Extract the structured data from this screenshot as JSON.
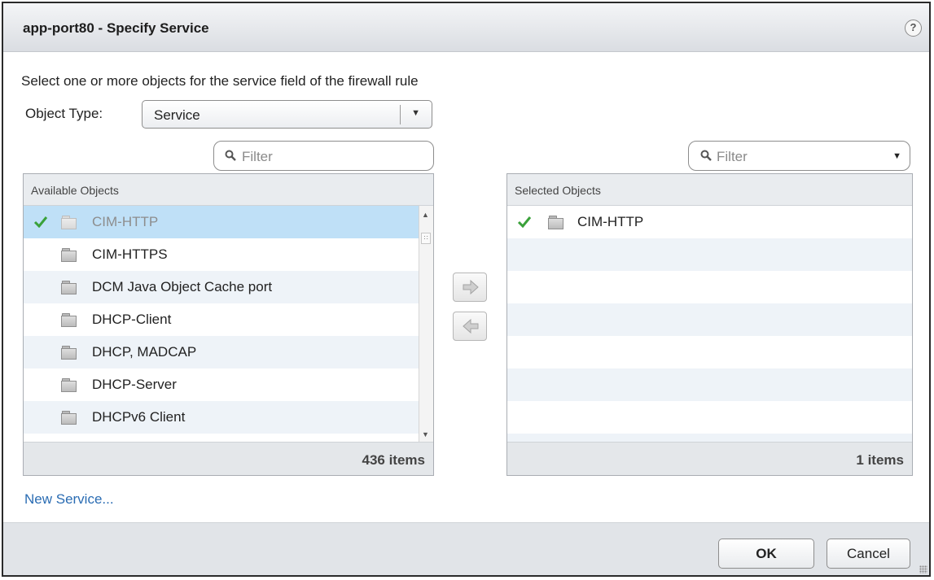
{
  "dialog": {
    "title": "app-port80 - Specify Service",
    "help_glyph": "?"
  },
  "instruction": "Select one or more objects for the service field of the firewall rule",
  "object_type": {
    "label": "Object Type:",
    "value": "Service"
  },
  "filter_left": {
    "placeholder": "Filter"
  },
  "filter_right": {
    "placeholder": "Filter"
  },
  "available": {
    "header": "Available Objects",
    "items": [
      {
        "label": "CIM-HTTP",
        "checked": true,
        "dimmed": true,
        "selected": true
      },
      {
        "label": "CIM-HTTPS"
      },
      {
        "label": "DCM Java Object Cache port"
      },
      {
        "label": "DHCP-Client"
      },
      {
        "label": "DHCP, MADCAP"
      },
      {
        "label": "DHCP-Server"
      },
      {
        "label": "DHCPv6 Client"
      }
    ],
    "count": "436 items"
  },
  "selected": {
    "header": "Selected Objects",
    "items": [
      {
        "label": "CIM-HTTP",
        "checked": true
      }
    ],
    "count": "1 items"
  },
  "actions": {
    "new_service": "New Service...",
    "ok": "OK",
    "cancel": "Cancel"
  },
  "icons": {
    "help": "help-icon",
    "dropdown": "chevron-down-icon",
    "search": "search-icon",
    "check": "checkmark-icon",
    "service": "folder-icon",
    "move_right": "arrow-right-icon",
    "move_left": "arrow-left-icon",
    "resize": "resize-grip-icon"
  },
  "colors": {
    "selected_row": "#bfe0f7",
    "alt_row": "#eef3f8",
    "link": "#2a6cb3",
    "check": "#3aa13a"
  }
}
